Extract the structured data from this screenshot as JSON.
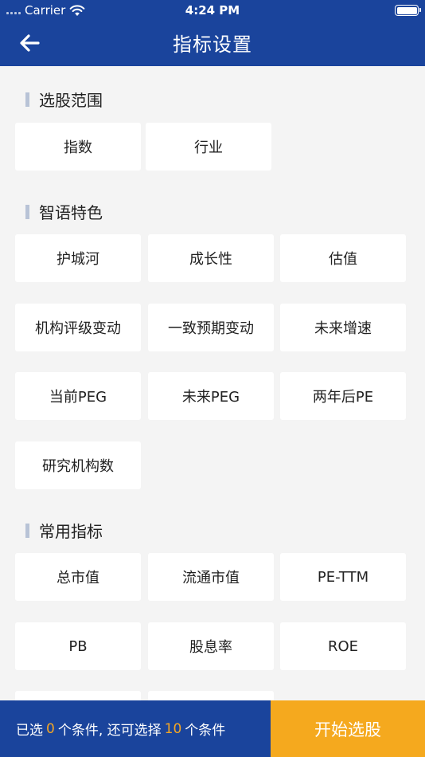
{
  "status_bar": {
    "carrier": "Carrier",
    "time": "4:24 PM"
  },
  "nav": {
    "title": "指标设置"
  },
  "sections": [
    {
      "title": "选股范围",
      "items": [
        "指数",
        "行业"
      ]
    },
    {
      "title": "智语特色",
      "items": [
        "护城河",
        "成长性",
        "估值",
        "机构评级变动",
        "一致预期变动",
        "未来增速",
        "当前PEG",
        "未来PEG",
        "两年后PE",
        "研究机构数"
      ]
    },
    {
      "title": "常用指标",
      "items": [
        "总市值",
        "流通市值",
        "PE-TTM",
        "PB",
        "股息率",
        "ROE"
      ]
    }
  ],
  "footer": {
    "prefix": "已选",
    "selected_count": "0",
    "middle": "个条件, 还可选择",
    "remaining_count": "10",
    "suffix": "个条件",
    "start_button": "开始选股"
  },
  "colors": {
    "primary": "#1a449c",
    "accent": "#f5a91e",
    "highlight": "#f5a623"
  }
}
